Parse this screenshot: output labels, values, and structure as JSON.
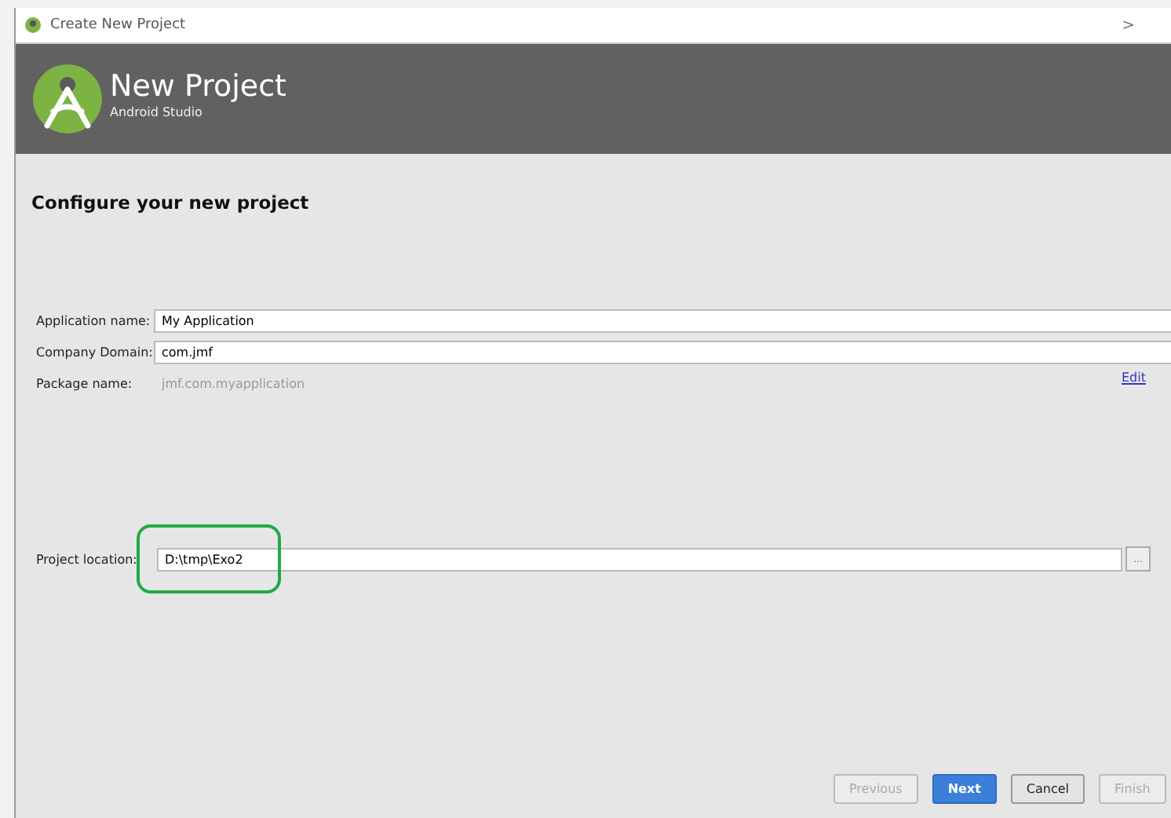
{
  "window": {
    "title": "Create New Project",
    "close": ">"
  },
  "header": {
    "title": "New Project",
    "subtitle": "Android Studio"
  },
  "section_title": "Configure your new project",
  "fields": [
    {
      "kind": "input",
      "label": "Application name:",
      "value": "My Application"
    },
    {
      "kind": "input",
      "label": "Company Domain:",
      "value": "com.jmf"
    },
    {
      "kind": "readonly",
      "label": "Package name:",
      "value": "jmf.com.myapplication",
      "link": "Edit"
    }
  ],
  "location": {
    "label": "Project location:",
    "value": "D:\\tmp\\Exo2",
    "browse": "...",
    "highlighted": true
  },
  "buttons": [
    {
      "label": "Previous",
      "kind": "default",
      "disabled": true
    },
    {
      "label": "Next",
      "kind": "primary",
      "disabled": false
    },
    {
      "label": "Cancel",
      "kind": "default",
      "disabled": false
    },
    {
      "label": "Finish",
      "kind": "default",
      "disabled": true
    }
  ]
}
